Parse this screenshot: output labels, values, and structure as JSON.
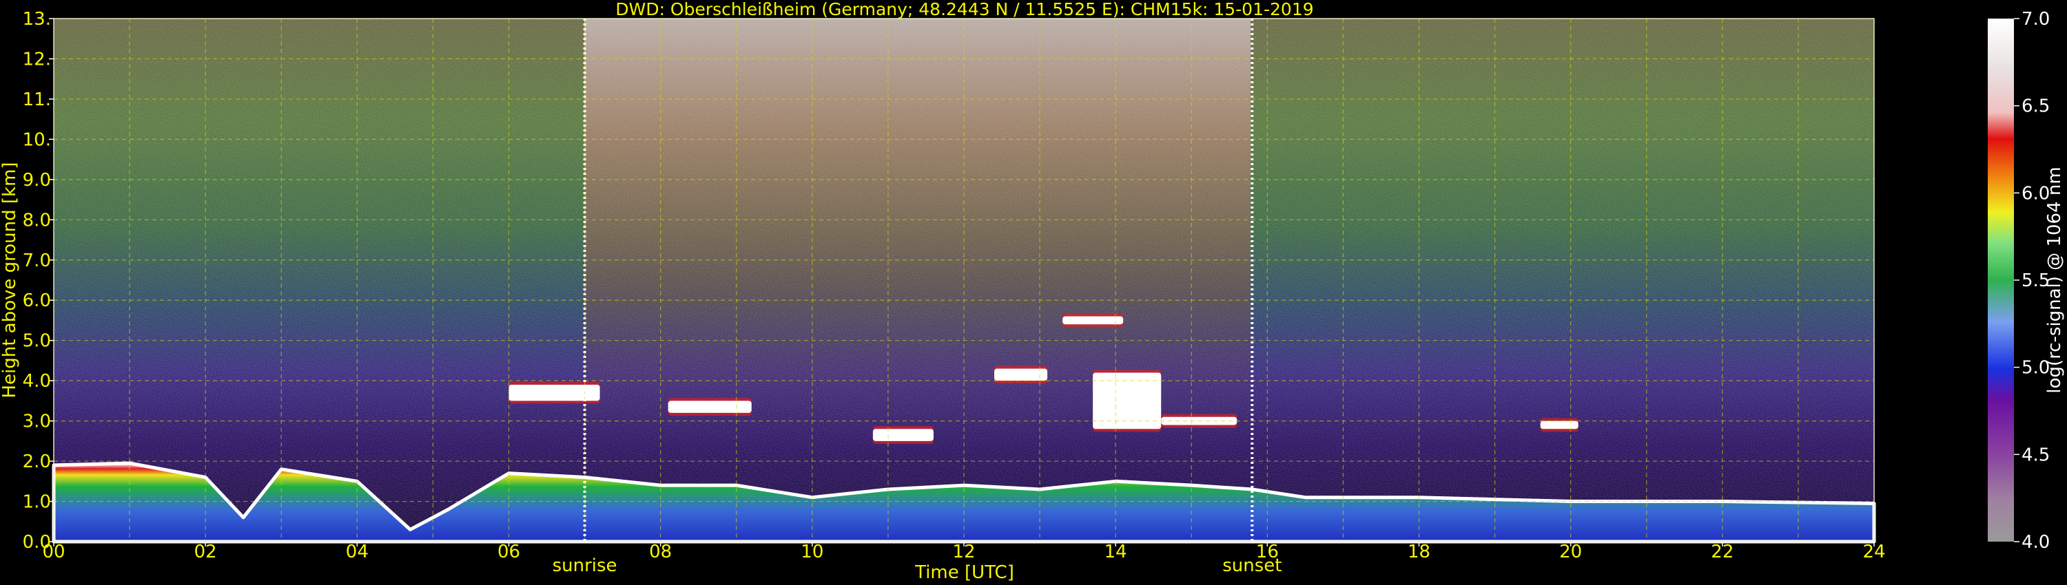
{
  "chart_data": {
    "type": "heatmap",
    "title": "DWD: Oberschleißheim (Germany; 48.2443 N / 11.5525 E):    CHM15k: 15-01-2019",
    "xlabel": "Time [UTC]",
    "ylabel": "Height above ground [km]",
    "xlim": [
      0,
      24
    ],
    "ylim": [
      0,
      13
    ],
    "x_ticks": [
      "00",
      "02",
      "04",
      "06",
      "08",
      "10",
      "12",
      "14",
      "16",
      "18",
      "20",
      "22",
      "24"
    ],
    "y_ticks": [
      "0.0",
      "1.0",
      "2.0",
      "3.0",
      "4.0",
      "5.0",
      "6.0",
      "7.0",
      "8.0",
      "9.0",
      "10.",
      "11.",
      "12.",
      "13."
    ],
    "grid": true,
    "markers": [
      {
        "label": "sunrise",
        "x": 7.0
      },
      {
        "label": "sunset",
        "x": 15.8
      }
    ],
    "colorbar": {
      "label": "log(rc-signal) @ 1064 nm",
      "range": [
        4.0,
        7.0
      ],
      "ticks": [
        "4.0",
        "4.5",
        "5.0",
        "5.5",
        "6.0",
        "6.5",
        "7.0"
      ]
    },
    "cloud_layers": [
      {
        "t0": 6.0,
        "t1": 7.2,
        "h0": 3.5,
        "h1": 3.9
      },
      {
        "t0": 8.1,
        "t1": 9.2,
        "h0": 3.2,
        "h1": 3.5
      },
      {
        "t0": 10.8,
        "t1": 11.6,
        "h0": 2.5,
        "h1": 2.8
      },
      {
        "t0": 12.4,
        "t1": 13.1,
        "h0": 4.0,
        "h1": 4.3
      },
      {
        "t0": 13.7,
        "t1": 14.6,
        "h0": 2.8,
        "h1": 4.2
      },
      {
        "t0": 14.6,
        "t1": 15.6,
        "h0": 2.9,
        "h1": 3.1
      },
      {
        "t0": 13.3,
        "t1": 14.1,
        "h0": 5.4,
        "h1": 5.6
      },
      {
        "t0": 19.6,
        "t1": 20.1,
        "h0": 2.8,
        "h1": 3.0
      }
    ],
    "boundary_layer_top": [
      [
        0.0,
        1.9
      ],
      [
        1.0,
        1.95
      ],
      [
        2.0,
        1.6
      ],
      [
        2.5,
        0.6
      ],
      [
        3.0,
        1.8
      ],
      [
        4.0,
        1.5
      ],
      [
        4.7,
        0.3
      ],
      [
        5.2,
        0.8
      ],
      [
        6.0,
        1.7
      ],
      [
        7.0,
        1.6
      ],
      [
        8.0,
        1.4
      ],
      [
        9.0,
        1.4
      ],
      [
        10.0,
        1.1
      ],
      [
        11.0,
        1.3
      ],
      [
        12.0,
        1.4
      ],
      [
        13.0,
        1.3
      ],
      [
        14.0,
        1.5
      ],
      [
        15.0,
        1.4
      ],
      [
        15.8,
        1.3
      ],
      [
        16.5,
        1.1
      ],
      [
        18.0,
        1.1
      ],
      [
        20.0,
        1.0
      ],
      [
        22.0,
        1.0
      ],
      [
        24.0,
        0.95
      ]
    ]
  }
}
